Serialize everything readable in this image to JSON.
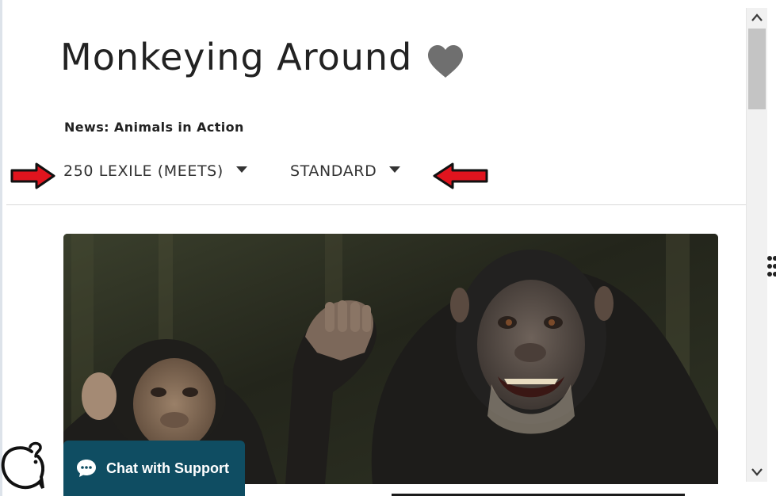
{
  "article": {
    "title": "Monkeying Around",
    "collection": "News: Animals in Action"
  },
  "selectors": {
    "lexile_label": "250 LEXILE (MEETS)",
    "version_label": "STANDARD"
  },
  "hero": {
    "alt": "chimpanzee-photo"
  },
  "chat": {
    "label": "Chat with Support"
  },
  "colors": {
    "chat_bg": "#0f4d62",
    "heart": "#6f6f6f",
    "annotation_arrow": "#e0141e"
  },
  "icons": {
    "favorite": "heart-icon",
    "caret": "caret-down-icon",
    "chat": "chat-bubble-icon",
    "help": "help-question-icon"
  }
}
